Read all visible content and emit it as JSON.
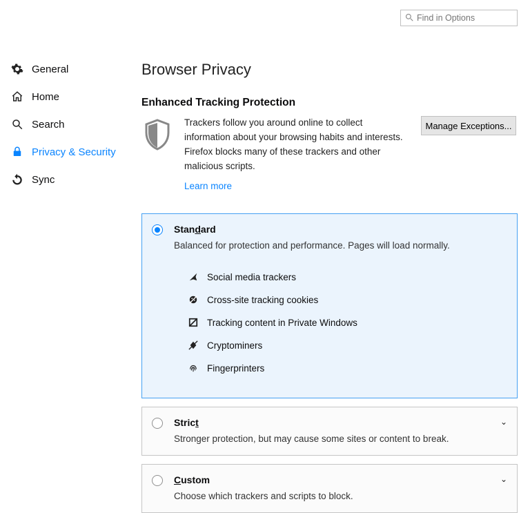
{
  "search": {
    "placeholder": "Find in Options"
  },
  "sidebar": {
    "items": [
      {
        "label": "General"
      },
      {
        "label": "Home"
      },
      {
        "label": "Search"
      },
      {
        "label": "Privacy & Security"
      },
      {
        "label": "Sync"
      }
    ]
  },
  "page": {
    "title": "Browser Privacy",
    "section_heading": "Enhanced Tracking Protection",
    "intro": "Trackers follow you around online to collect information about your browsing habits and interests. Firefox blocks many of these trackers and other malicious scripts.",
    "learn_more": "Learn more",
    "manage_btn": "Manage Exceptions..."
  },
  "options": {
    "standard": {
      "label_pre": "Stan",
      "label_ul": "d",
      "label_post": "ard",
      "desc": "Balanced for protection and performance. Pages will load normally.",
      "trackers": [
        "Social media trackers",
        "Cross-site tracking cookies",
        "Tracking content in Private Windows",
        "Cryptominers",
        "Fingerprinters"
      ]
    },
    "strict": {
      "label_pre": "Stric",
      "label_ul": "t",
      "label_post": "",
      "desc": "Stronger protection, but may cause some sites or content to break."
    },
    "custom": {
      "label_pre": "",
      "label_ul": "C",
      "label_post": "ustom",
      "desc": "Choose which trackers and scripts to block."
    }
  }
}
